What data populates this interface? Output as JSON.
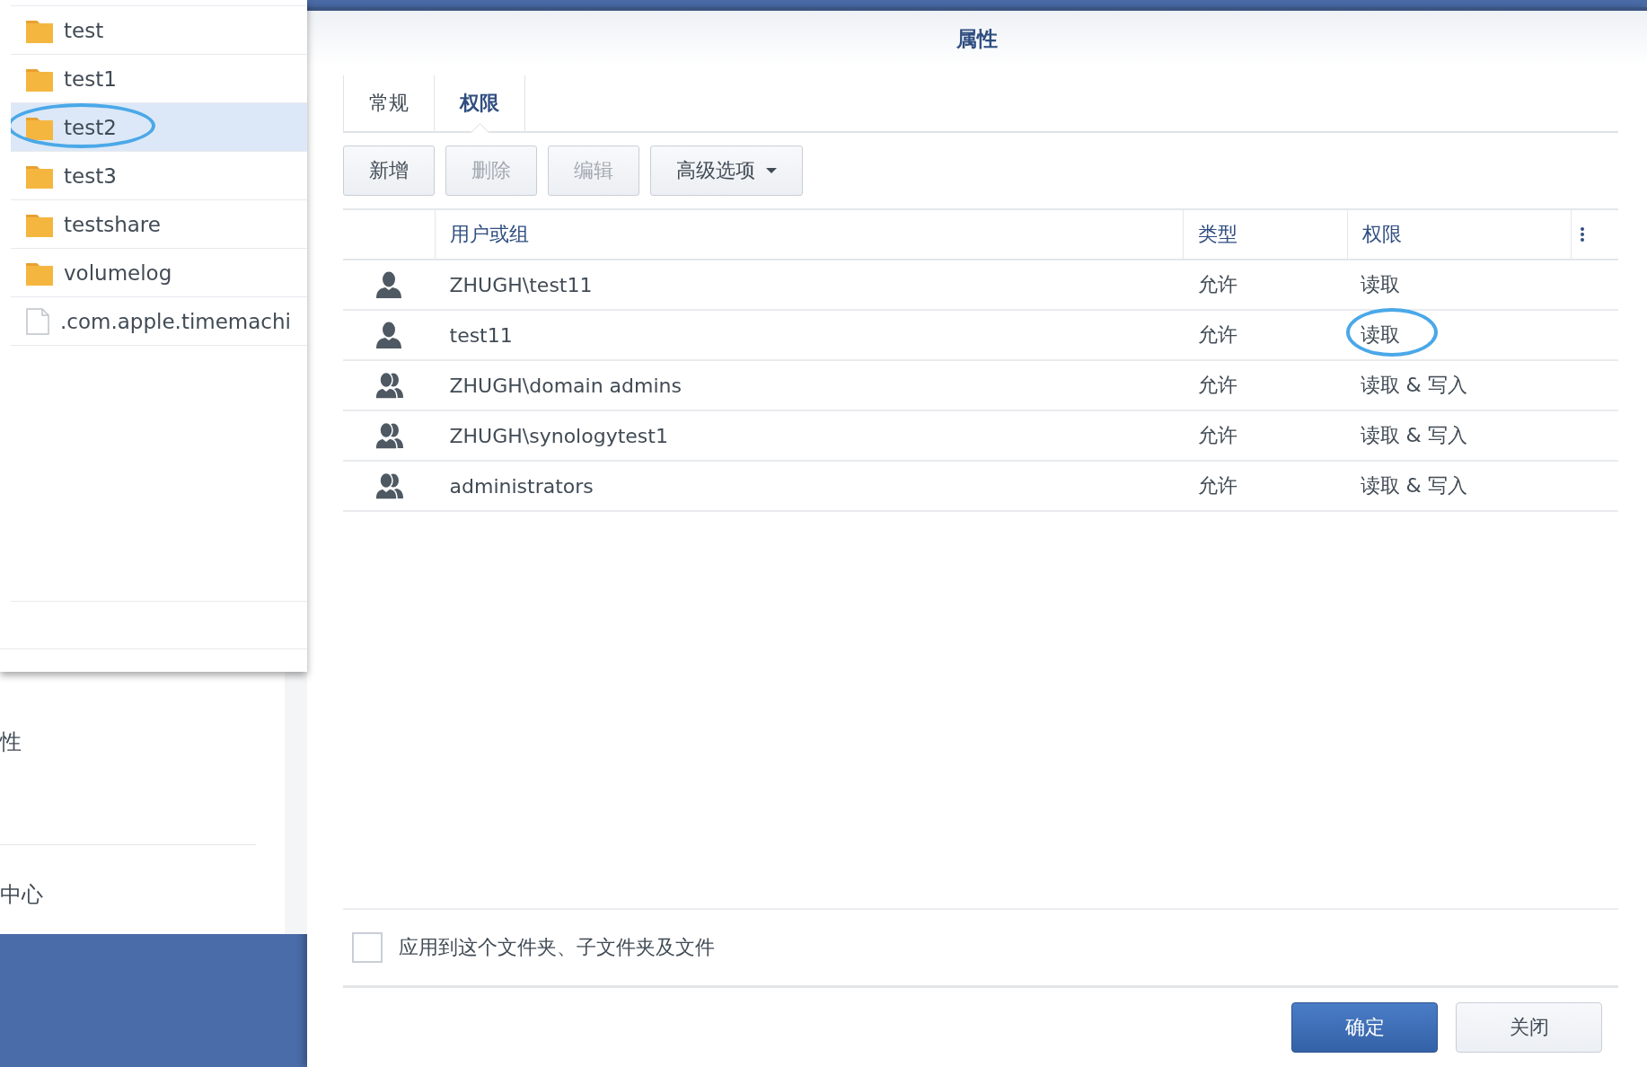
{
  "file_list": [
    {
      "name": "test",
      "kind": "folder",
      "selected": false,
      "circled": false
    },
    {
      "name": "test1",
      "kind": "folder",
      "selected": false,
      "circled": false
    },
    {
      "name": "test2",
      "kind": "folder",
      "selected": true,
      "circled": true
    },
    {
      "name": "test3",
      "kind": "folder",
      "selected": false,
      "circled": false
    },
    {
      "name": "testshare",
      "kind": "folder",
      "selected": false,
      "circled": false
    },
    {
      "name": "volumelog",
      "kind": "folder",
      "selected": false,
      "circled": false
    },
    {
      "name": ".com.apple.timemachi",
      "kind": "file",
      "selected": false,
      "circled": false
    }
  ],
  "back_panel": {
    "items": [
      "性",
      "中心"
    ]
  },
  "dialog": {
    "title": "属性",
    "tabs": [
      {
        "label": "常规",
        "selected": false
      },
      {
        "label": "权限",
        "selected": true
      }
    ],
    "toolbar": [
      {
        "label": "新增",
        "disabled": false,
        "kind": "button"
      },
      {
        "label": "删除",
        "disabled": true,
        "kind": "button"
      },
      {
        "label": "编辑",
        "disabled": true,
        "kind": "button"
      },
      {
        "label": "高级选项",
        "disabled": false,
        "kind": "dropdown"
      }
    ],
    "table": {
      "columns": [
        "用户或组",
        "类型",
        "权限"
      ],
      "rows": [
        {
          "kind": "user",
          "name": "ZHUGH\\test11",
          "type": "允许",
          "permission": "读取",
          "circled": false
        },
        {
          "kind": "user",
          "name": "test11",
          "type": "允许",
          "permission": "读取",
          "circled": true
        },
        {
          "kind": "group",
          "name": "ZHUGH\\domain admins",
          "type": "允许",
          "permission": "读取 & 写入",
          "circled": false
        },
        {
          "kind": "group",
          "name": "ZHUGH\\synologytest1",
          "type": "允许",
          "permission": "读取 & 写入",
          "circled": false
        },
        {
          "kind": "group",
          "name": "administrators",
          "type": "允许",
          "permission": "读取 & 写入",
          "circled": false
        }
      ]
    },
    "apply_option": {
      "label": "应用到这个文件夹、子文件夹及文件",
      "checked": false
    },
    "buttons": [
      {
        "label": "确定",
        "kind": "primary"
      },
      {
        "label": "关闭",
        "kind": "secondary"
      }
    ]
  }
}
